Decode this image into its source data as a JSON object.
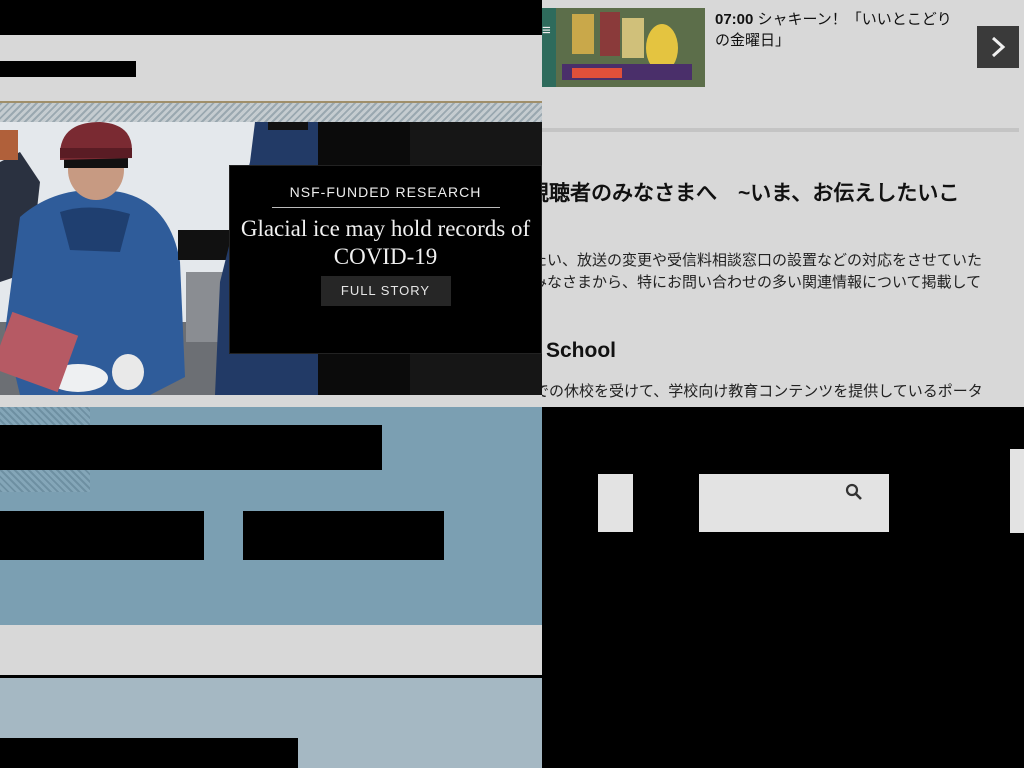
{
  "hero": {
    "eyebrow": "NSF-FUNDED RESEARCH",
    "title": "Glacial ice may hold records of COVID-19",
    "cta_label": "FULL STORY"
  },
  "schedule": {
    "time": "07:00",
    "program": "シャキーン！「いいとこどり",
    "program_line2": "の金曜日」"
  },
  "notice": {
    "heading": "視聴者のみなさまへ　~いま、お伝えしたいこ",
    "body_line1": "たい、放送の変更や受信料相談窓口の設置などの対応をさせていた",
    "body_line2": "みなさまから、特にお問い合わせの多い関連情報について掲載して"
  },
  "school": {
    "heading": "School",
    "body_line1": "での休校を受けて、学校向け教育コンテンツを提供しているポータ"
  },
  "icons": {
    "next": "chevron-right-icon",
    "search": "search-icon",
    "menu": "menu-icon"
  },
  "colors": {
    "page_bg": "#d8d8d8",
    "blue_band": "#7b9fb2",
    "pale_blue": "#a5b8c3",
    "gold_rule": "#a08f6a"
  }
}
